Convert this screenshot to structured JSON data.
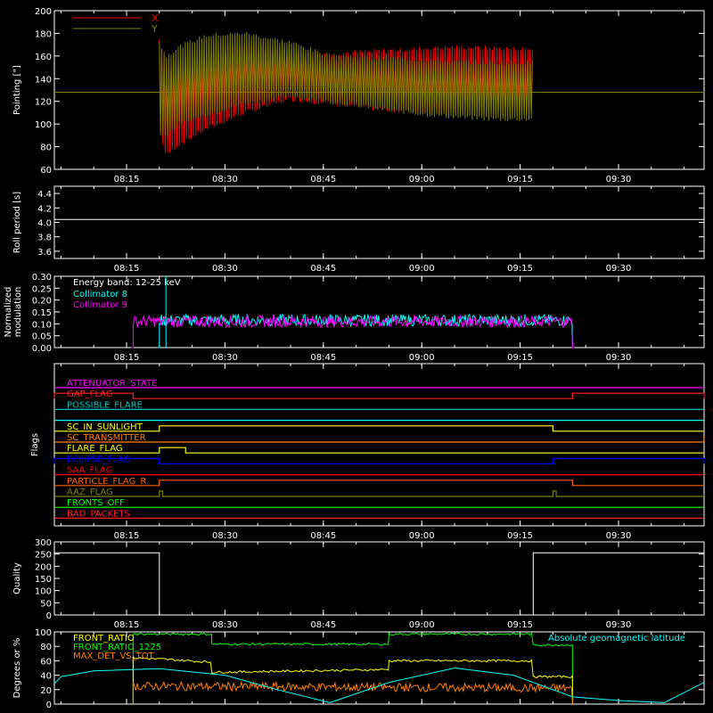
{
  "style": {
    "background": "#000000",
    "axis_color": "#ffffff"
  },
  "time_ticks": [
    "08:15",
    "08:30",
    "08:45",
    "09:00",
    "09:15",
    "09:30"
  ],
  "chart_data": [
    {
      "type": "line",
      "id": "pointing",
      "ylabel": "Pointing [\"]",
      "ylim": [
        60,
        200
      ],
      "yticks": [
        "60",
        "80",
        "100",
        "120",
        "140",
        "160",
        "180",
        "200"
      ],
      "legend": [
        {
          "name": "X",
          "color": "#ff0000"
        },
        {
          "name": "Y",
          "color": "#808000"
        }
      ],
      "series": [
        {
          "name": "X",
          "color": "#ff0000",
          "envelope_time": [
            "08:20",
            "08:21",
            "08:23",
            "08:27",
            "08:33",
            "08:40",
            "08:46",
            "08:55",
            "09:05",
            "09:12",
            "09:17"
          ],
          "upper": [
            175,
            152,
            158,
            165,
            170,
            166,
            162,
            165,
            168,
            167,
            166
          ],
          "lower": [
            95,
            72,
            82,
            95,
            110,
            122,
            118,
            112,
            110,
            112,
            114
          ]
        },
        {
          "name": "Y",
          "color": "#808000",
          "envelope_time": [
            "08:20",
            "08:21",
            "08:23",
            "08:27",
            "08:33",
            "08:40",
            "08:46",
            "08:55",
            "09:05",
            "09:12",
            "09:17"
          ],
          "upper": [
            172,
            160,
            168,
            178,
            180,
            172,
            160,
            158,
            155,
            154,
            154
          ],
          "lower": [
            90,
            90,
            100,
            108,
            118,
            125,
            120,
            112,
            106,
            104,
            104
          ]
        }
      ],
      "baseline": 128
    },
    {
      "type": "line",
      "id": "roll",
      "ylabel": "Roll period [s]",
      "ylim": [
        3.5,
        4.5
      ],
      "yticks": [
        "3.6",
        "3.8",
        "4.0",
        "4.2",
        "4.4"
      ],
      "series": [
        {
          "name": "",
          "color": "#ffffff",
          "x": [
            "08:00",
            "09:45"
          ],
          "values": [
            4.04,
            4.04
          ]
        }
      ]
    },
    {
      "type": "line",
      "id": "modulation",
      "ylabel": "Normalized modulation",
      "ylim": [
        0,
        0.3
      ],
      "yticks": [
        "0.00",
        "0.05",
        "0.10",
        "0.15",
        "0.20",
        "0.25",
        "0.30"
      ],
      "annotation": "Energy band: 12-25 keV",
      "legend": [
        {
          "name": "Collimator 8",
          "color": "#00ffff"
        },
        {
          "name": "Collimator 9",
          "color": "#ff00ff"
        }
      ],
      "series": [
        {
          "name": "Collimator 8",
          "color": "#00ffff",
          "start": "08:20",
          "end": "09:23",
          "mean": 0.115,
          "spread": 0.025
        },
        {
          "name": "Collimator 9",
          "color": "#ff00ff",
          "start": "08:16",
          "end": "09:23",
          "mean": 0.11,
          "spread": 0.025
        }
      ]
    },
    {
      "type": "line",
      "id": "flags",
      "ylabel": "Flags",
      "flags": [
        {
          "name": "ATTENUATOR_STATE",
          "color": "#ff00ff",
          "high_intervals": []
        },
        {
          "name": "GAP_FLAG",
          "color": "#ff2020",
          "high_intervals": [
            [
              "08:00",
              "08:16"
            ],
            [
              "09:23",
              "09:45"
            ]
          ]
        },
        {
          "name": "POSSIBLE_FLARE",
          "color": "#00c0c0",
          "high_intervals": []
        },
        {
          "name": "SC_IN_SUNLIGHT",
          "color": "#00ffff",
          "high_intervals": []
        },
        {
          "name": "SC_IN_SUNLIGHT",
          "color": "#ffff00",
          "high_intervals": [
            [
              "08:20",
              "09:20"
            ]
          ]
        },
        {
          "name": "SC_TRANSMITTER",
          "color": "#ff8000",
          "high_intervals": [
            [
              "09:43",
              "09:45"
            ]
          ]
        },
        {
          "name": "FLARE_FLAG",
          "color": "#ffff00",
          "high_intervals": [
            [
              "08:20",
              "08:24"
            ]
          ]
        },
        {
          "name": "ECLIPSE_FLAG",
          "color": "#0000ff",
          "high_intervals": [
            [
              "08:00",
              "08:20"
            ],
            [
              "09:20",
              "09:45"
            ]
          ]
        },
        {
          "name": "SAA_FLAG",
          "color": "#ff0000",
          "high_intervals": []
        },
        {
          "name": "PARTICLE_FLAG_R",
          "color": "#ff6000",
          "high_intervals": [
            [
              "08:20",
              "09:23"
            ]
          ]
        },
        {
          "name": "AAZ_FLAG",
          "color": "#808000",
          "high_intervals": [
            [
              "08:20",
              "08:20.5"
            ],
            [
              "09:20",
              "09:20.5"
            ]
          ]
        },
        {
          "name": "FRONTS_OFF",
          "color": "#00ff00",
          "high_intervals": []
        },
        {
          "name": "BAD_PACKETS",
          "color": "#ff2020",
          "high_intervals": []
        }
      ],
      "visible_labels": [
        "ATTENUATOR_STATE",
        "GAP_FLAG",
        "POSSIBLE_FLARE",
        "SC_IN_SUNLIGHT",
        "SC_TRANSMITTER",
        "FLARE_FLAG",
        "ECLIPSE_FLAG",
        "SAA_FLAG",
        "PARTICLE_FLAG_R",
        "AAZ_FLAG",
        "FRONTS_OFF",
        "BAD_PACKETS"
      ]
    },
    {
      "type": "line",
      "id": "quality",
      "ylabel": "Quality",
      "ylim": [
        0,
        300
      ],
      "yticks": [
        "0",
        "50",
        "100",
        "150",
        "200",
        "250",
        "300"
      ],
      "series": [
        {
          "name": "",
          "color": "#ffffff",
          "x": [
            "08:00",
            "08:20",
            "08:20",
            "09:17",
            "09:17",
            "09:45"
          ],
          "values": [
            255,
            255,
            0,
            0,
            255,
            255
          ]
        }
      ]
    },
    {
      "type": "line",
      "id": "ratios",
      "ylabel": "Degrees or %",
      "ylim": [
        0,
        100
      ],
      "yticks": [
        "0",
        "20",
        "40",
        "60",
        "80",
        "100"
      ],
      "legend": [
        {
          "name": "FRONT_RATIO",
          "color": "#ffff00"
        },
        {
          "name": "FRONT_RATIO_1225",
          "color": "#00ff00"
        },
        {
          "name": "MAX_DET_VS_TOT",
          "color": "#ff8000"
        }
      ],
      "right_legend": {
        "name": "Absolute geomagnetic latitude",
        "color": "#00ffff"
      },
      "series": [
        {
          "name": "FRONT_RATIO_1225",
          "color": "#00ff00",
          "x": [
            "08:16",
            "08:28",
            "08:28",
            "08:55",
            "08:55",
            "09:17",
            "09:17",
            "09:23"
          ],
          "values": [
            97,
            97,
            83,
            83,
            97,
            97,
            82,
            82
          ]
        },
        {
          "name": "FRONT_RATIO",
          "color": "#ffff00",
          "x": [
            "08:16",
            "08:21",
            "08:28",
            "08:28",
            "08:55",
            "08:55",
            "09:17",
            "09:17",
            "09:23"
          ],
          "values": [
            64,
            62,
            58,
            44,
            48,
            60,
            60,
            38,
            38
          ]
        },
        {
          "name": "MAX_DET_VS_TOT",
          "color": "#ff8000",
          "x": [
            "08:16",
            "09:23"
          ],
          "values": [
            25,
            22
          ]
        },
        {
          "name": "Absolute geomagnetic latitude",
          "color": "#00ffff",
          "x": [
            "08:00",
            "08:05",
            "08:10",
            "08:20",
            "08:30",
            "08:38",
            "08:46",
            "08:55",
            "09:05",
            "09:14",
            "09:23",
            "09:30",
            "09:37",
            "09:45"
          ],
          "values": [
            28,
            38,
            46,
            49,
            40,
            20,
            2,
            30,
            50,
            40,
            10,
            5,
            2,
            30
          ]
        }
      ]
    }
  ]
}
